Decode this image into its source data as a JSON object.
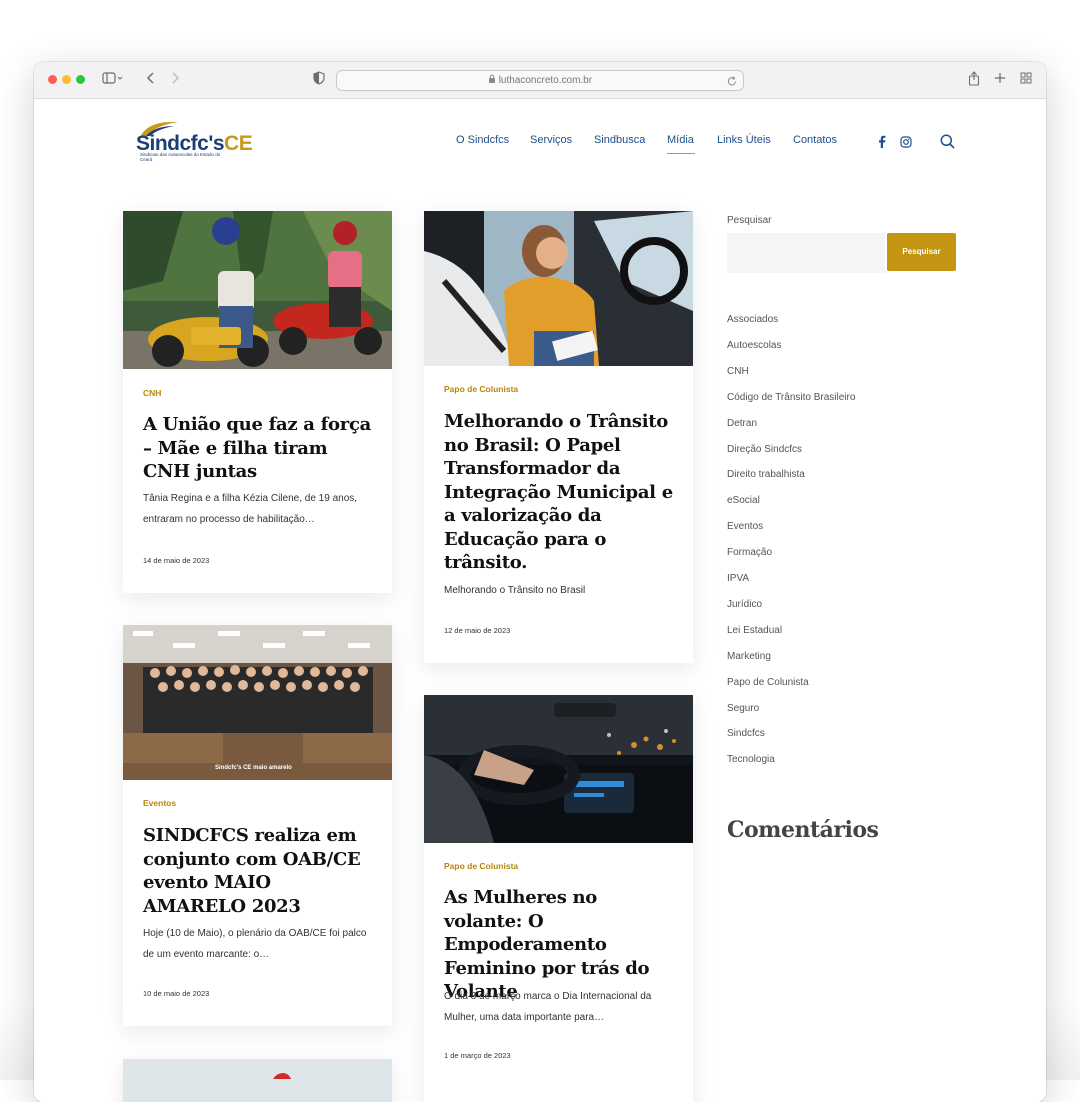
{
  "browser": {
    "url": "luthaconcreto.com.br"
  },
  "header": {
    "logo_main": "Sindcfc's",
    "logo_ce": "CE",
    "logo_sub": "Sindicato das Autoescolas do Estado do Ceará",
    "nav": [
      "O Sindcfcs",
      "Serviços",
      "Sindbusca",
      "Mídia",
      "Links Úteis",
      "Contatos"
    ],
    "active_nav": "Mídia"
  },
  "posts": [
    {
      "category": "CNH",
      "title": "A União que faz a força – Mãe e filha tiram CNH juntas",
      "excerpt": "Tânia Regina e a filha Kézia Cilene, de 19 anos, entraram no processo de habilitação…",
      "date": "14 de maio de 2023"
    },
    {
      "category": "Papo de Colunista",
      "title": "Melhorando o Trânsito no Brasil: O Papel Transformador da Integração Municipal e a valorização da Educação para o trânsito.",
      "excerpt": "Melhorando o Trânsito no Brasil",
      "date": "12 de maio de 2023"
    },
    {
      "category": "Eventos",
      "title": "SINDCFCS realiza em conjunto com OAB/CE evento MAIO AMARELO 2023",
      "excerpt": "Hoje (10 de Maio), o plenário da OAB/CE foi palco de um evento marcante: o…",
      "date": "10 de maio de 2023",
      "image_caption": "Sindcfc's CE  maio amarelo"
    },
    {
      "category": "Papo de Colunista",
      "title": "As Mulheres no volante: O Empoderamento Feminino por trás do Volante",
      "excerpt": "O dia 8 de março marca o Dia Internacional da Mulher, uma data importante para…",
      "date": "1 de março de 2023"
    }
  ],
  "sidebar": {
    "search_label": "Pesquisar",
    "search_button": "Pesquisar",
    "categories": [
      "Associados",
      "Autoescolas",
      "CNH",
      "Código de Trânsito Brasileiro",
      "Detran",
      "Direção Sindcfcs",
      "Direito trabalhista",
      "eSocial",
      "Eventos",
      "Formação",
      "IPVA",
      "Jurídico",
      "Lei Estadual",
      "Marketing",
      "Papo de Colunista",
      "Seguro",
      "Sindcfcs",
      "Tecnologia"
    ],
    "comments_heading": "Comentários"
  },
  "colors": {
    "brand_blue": "#1f4f8b",
    "brand_gold": "#c39513"
  },
  "icons": [
    "sidebar-toggle-icon",
    "back-icon",
    "forward-icon",
    "shield-icon",
    "lock-icon",
    "reload-icon",
    "share-icon",
    "new-tab-icon",
    "tab-overview-icon",
    "facebook-icon",
    "instagram-icon",
    "search-icon"
  ]
}
